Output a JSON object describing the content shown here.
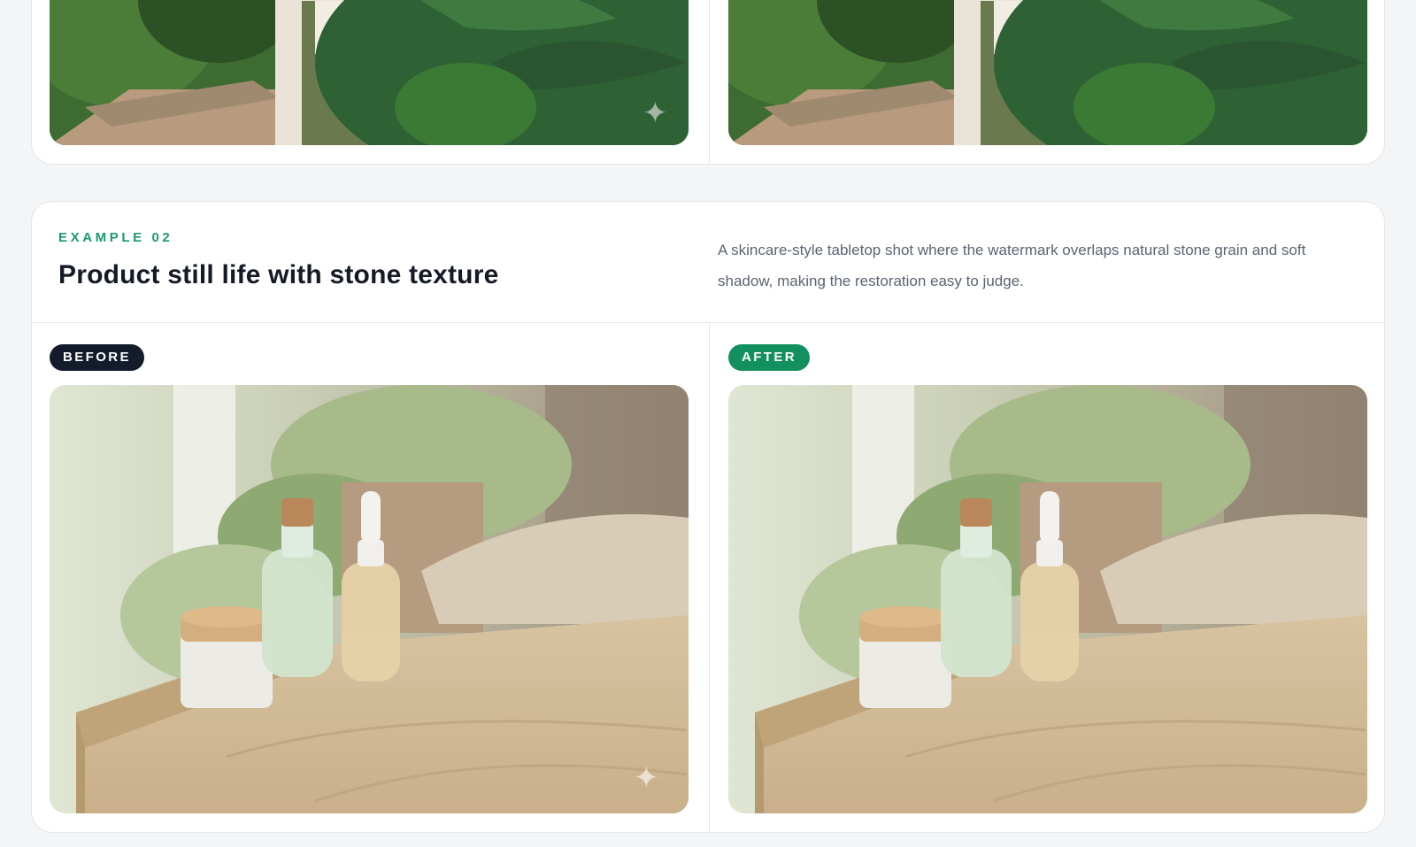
{
  "top_card": {
    "before_image": {
      "subject": "garden-portrait",
      "watermark": true
    },
    "after_image": {
      "subject": "garden-portrait",
      "watermark": false
    }
  },
  "example": {
    "eyebrow": "EXAMPLE 02",
    "title": "Product still life with stone texture",
    "description": "A skincare-style tabletop shot where the watermark overlaps natural stone grain and soft shadow, making the restoration easy to judge.",
    "before_label": "BEFORE",
    "after_label": "AFTER",
    "before_image": {
      "subject": "skincare-bottles-on-travertine",
      "watermark": true
    },
    "after_image": {
      "subject": "skincare-bottles-on-travertine",
      "watermark": false
    }
  },
  "colors": {
    "accent": "#1b9a6d",
    "before_badge": "#141c2c",
    "after_badge": "#12905f",
    "title": "#141a26",
    "body_text": "#5b6472",
    "border": "#e2e7ea"
  }
}
